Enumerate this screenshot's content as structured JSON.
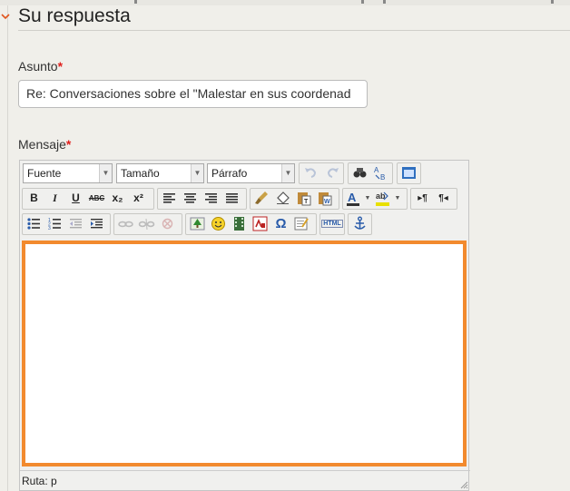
{
  "legend": "Su respuesta",
  "subject": {
    "label": "Asunto",
    "required_mark": "*",
    "value": "Re: Conversaciones sobre el \"Malestar en sus coordenad"
  },
  "message": {
    "label": "Mensaje",
    "required_mark": "*"
  },
  "editor": {
    "font_select": "Fuente",
    "size_select": "Tamaño",
    "format_select": "Párrafo",
    "toolbar1": [
      "undo-icon",
      "redo-icon",
      "find-icon",
      "replace-icon",
      "fullscreen-icon"
    ],
    "toolbar2": {
      "bold": "B",
      "italic": "I",
      "underline": "U",
      "strike": "ABC",
      "subscript": "x₂",
      "superscript": "x²"
    },
    "html_button": "HTML",
    "status_path": "Ruta: p",
    "accent_color": "#f28a2e"
  }
}
